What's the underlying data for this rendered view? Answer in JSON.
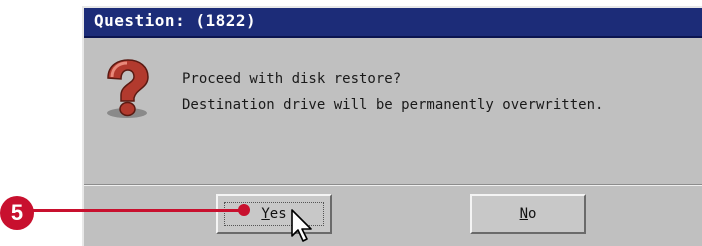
{
  "dialog": {
    "title": "Question: (1822)",
    "icon": "question-mark-icon",
    "message_line1": "Proceed with disk restore?",
    "message_line2": "Destination drive will be permanently overwritten."
  },
  "buttons": {
    "yes_underlined": "Y",
    "yes_rest": "es",
    "no_underlined": "N",
    "no_rest": "o"
  },
  "annotation": {
    "step_number": "5",
    "color": "#c8102e"
  },
  "colors": {
    "titlebar": "#1c2c78",
    "dialog_bg": "#c0c0c0"
  }
}
